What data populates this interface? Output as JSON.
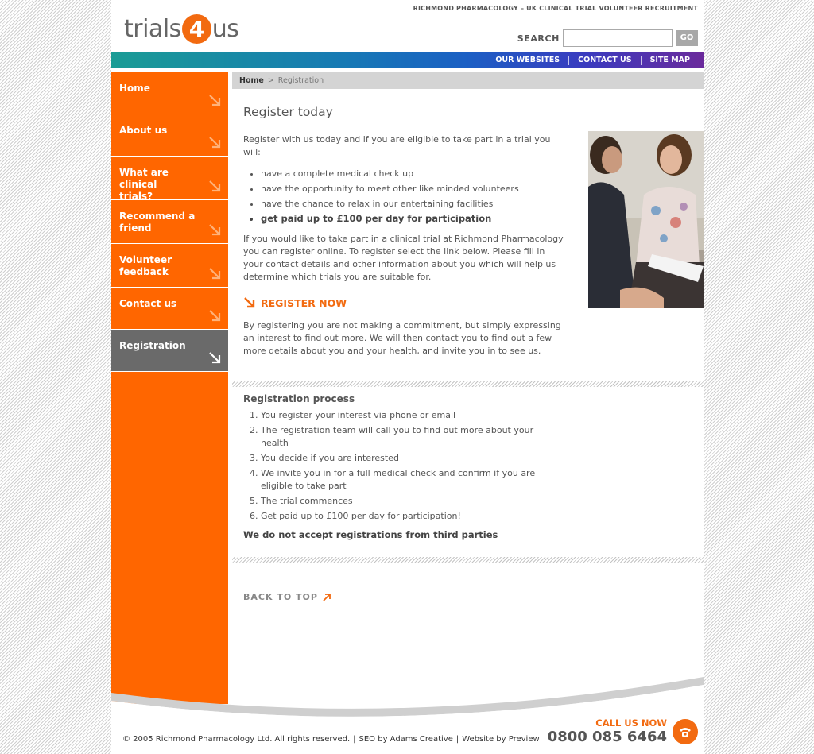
{
  "header": {
    "tagline": "RICHMOND PHARMACOLOGY – UK CLINICAL TRIAL VOLUNTEER RECRUITMENT",
    "logo": {
      "before": "trials",
      "digit": "4",
      "after": "us"
    },
    "search_label": "SEARCH",
    "search_value": "",
    "go_label": "GO"
  },
  "topnav": [
    {
      "label": "OUR WEBSITES"
    },
    {
      "label": "CONTACT US"
    },
    {
      "label": "SITE MAP"
    }
  ],
  "sidebar": {
    "items": [
      {
        "label": "Home",
        "active": false
      },
      {
        "label": "About us",
        "active": false
      },
      {
        "label": "What are clinical trials?",
        "active": false
      },
      {
        "label": "Recommend a friend",
        "active": false
      },
      {
        "label": "Volunteer feedback",
        "active": false
      },
      {
        "label": "Contact us",
        "active": false
      },
      {
        "label": "Registration",
        "active": true
      }
    ]
  },
  "breadcrumb": {
    "home": "Home",
    "separator": ">",
    "current": "Registration"
  },
  "main": {
    "title": "Register today",
    "intro": "Register with us today and if you are eligible to take part in a trial you will:",
    "benefits": [
      "have a complete medical check up",
      "have the opportunity to meet other like minded volunteers",
      "have the chance to relax in our entertaining facilities",
      "get paid up to £100 per day for participation"
    ],
    "para2": "If you would like to take part in a clinical trial at Richmond Pharmacology you can register online. To register select the link below. Please fill in your contact details and other information about you which will help us determine which trials you are suitable for.",
    "register_label": "REGISTER NOW",
    "para3": "By registering you are not making a commitment, but simply expressing an interest to find out more. We will then contact you to find out a few more details about you and your health, and invite you in to see us."
  },
  "process": {
    "title": "Registration process",
    "steps": [
      "You register your interest via phone or email",
      "The registration team will call you to find out more about your health",
      "You decide if you are interested",
      "We invite you in for a full medical check and confirm if you are eligible to take part",
      "The trial commences",
      "Get paid up to £100 per day for participation!"
    ],
    "notice": "We do not accept registrations from third parties"
  },
  "back_to_top": "BACK TO TOP",
  "footer": {
    "copyright": "© 2005 Richmond Pharmacology Ltd. All rights reserved.",
    "seo": "SEO by Adams Creative",
    "website": "Website by Preview",
    "separator": "|",
    "call_label": "CALL US NOW",
    "phone": "0800 085 6464"
  },
  "colors": {
    "accent": "#ff6600",
    "active_nav": "#6a6a6a",
    "breadcrumb_bg": "#d4d4d4"
  }
}
